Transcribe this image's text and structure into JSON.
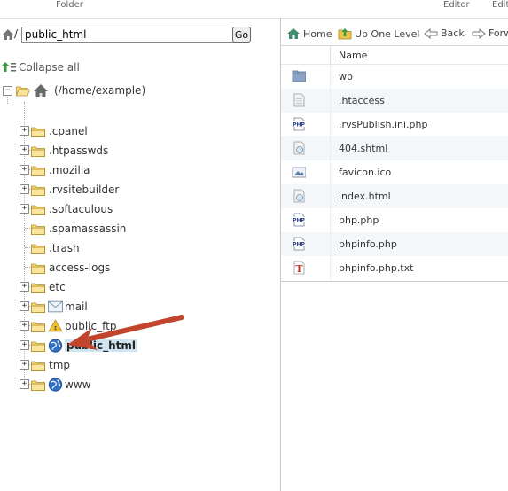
{
  "header": {
    "col_folder": "Folder",
    "col_editor": "Editor",
    "col_edit_partial": "Edit"
  },
  "path": {
    "value": "public_html",
    "separator": "/",
    "go_label": "Go"
  },
  "tree": {
    "collapse_label": "Collapse all",
    "root_label": "(/home/example)",
    "items": [
      {
        "label": ".cpanel",
        "icon": "folder-icon",
        "expander": "+"
      },
      {
        "label": ".htpasswds",
        "icon": "folder-icon",
        "expander": "+"
      },
      {
        "label": ".mozilla",
        "icon": "folder-icon",
        "expander": "+"
      },
      {
        "label": ".rvsitebuilder",
        "icon": "folder-icon",
        "expander": "+"
      },
      {
        "label": ".softaculous",
        "icon": "folder-icon",
        "expander": "+"
      },
      {
        "label": ".spamassassin",
        "icon": "folder-icon",
        "expander": ""
      },
      {
        "label": ".trash",
        "icon": "folder-icon",
        "expander": ""
      },
      {
        "label": "access-logs",
        "icon": "folder-icon",
        "expander": ""
      },
      {
        "label": "etc",
        "icon": "folder-icon",
        "expander": "+"
      },
      {
        "label": "mail",
        "icon": "mail-icon",
        "expander": "+"
      },
      {
        "label": "public_ftp",
        "icon": "ftp-icon",
        "expander": "+"
      },
      {
        "label": "public_html",
        "icon": "globe-icon",
        "expander": "+",
        "selected": true
      },
      {
        "label": "tmp",
        "icon": "folder-icon",
        "expander": "+"
      },
      {
        "label": "www",
        "icon": "globe-icon",
        "expander": "+"
      }
    ]
  },
  "toolbar": {
    "home": "Home",
    "up_one_level": "Up One Level",
    "back": "Back",
    "forward_partial": "Forw"
  },
  "files": {
    "column_name": "Name",
    "rows": [
      {
        "name": "wp",
        "icon": "folder-icon"
      },
      {
        "name": ".htaccess",
        "icon": "text-file-icon"
      },
      {
        "name": ".rvsPublish.ini.php",
        "icon": "php-file-icon"
      },
      {
        "name": "404.shtml",
        "icon": "html-file-icon"
      },
      {
        "name": "favicon.ico",
        "icon": "image-file-icon"
      },
      {
        "name": "index.html",
        "icon": "html-file-icon"
      },
      {
        "name": "php.php",
        "icon": "php-file-icon"
      },
      {
        "name": "phpinfo.php",
        "icon": "php-file-icon"
      },
      {
        "name": "phpinfo.php.txt",
        "icon": "txt-file-icon"
      }
    ]
  },
  "colors": {
    "selection": "#cfe4f0",
    "arrow": "#c0452c",
    "alt_row": "#f3f7fa"
  }
}
